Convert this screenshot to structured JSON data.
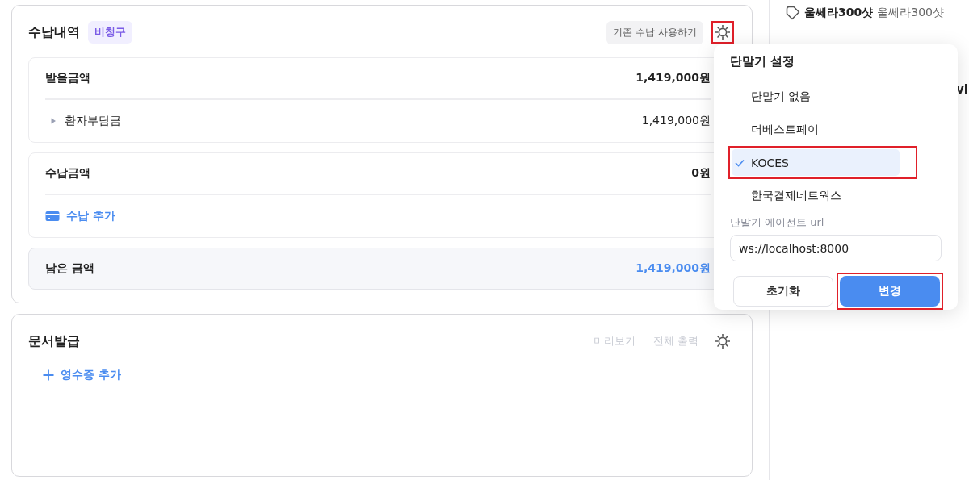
{
  "payment": {
    "title": "수납내역",
    "badge": "비청구",
    "legacy_button": "기존 수납 사용하기",
    "settings_highlighted": true,
    "receivable": {
      "label": "받을금액",
      "amount": "1,419,000원",
      "items": [
        {
          "label": "환자부담금",
          "amount": "1,419,000원",
          "expanded": false
        }
      ]
    },
    "paid": {
      "label": "수납금액",
      "amount": "0원",
      "add_label": "수납 추가"
    },
    "remaining": {
      "label": "남은 금액",
      "amount": "1,419,000원"
    }
  },
  "documents": {
    "title": "문서발급",
    "actions": [
      {
        "label": "미리보기",
        "disabled": true
      },
      {
        "label": "전체 출력",
        "disabled": true
      }
    ],
    "add_label": "영수증 추가"
  },
  "terminal_menu": {
    "title": "단말기 설정",
    "options": [
      {
        "label": "단말기 없음",
        "selected": false,
        "highlighted": false
      },
      {
        "label": "더베스트페이",
        "selected": false,
        "highlighted": false
      },
      {
        "label": "KOCES",
        "selected": true,
        "highlighted": true
      },
      {
        "label": "한국결제네트웍스",
        "selected": false,
        "highlighted": false
      }
    ],
    "url_label": "단말기 에이전트 url",
    "url_value": "ws://localhost:8000",
    "buttons": [
      {
        "label": "초기화",
        "kind": "secondary",
        "highlighted": false
      },
      {
        "label": "변경",
        "kind": "primary",
        "highlighted": true
      }
    ]
  },
  "side": {
    "item": {
      "name": "울쎄라300샷",
      "detail": "울쎄라300샷"
    },
    "cut_text": "vi"
  }
}
